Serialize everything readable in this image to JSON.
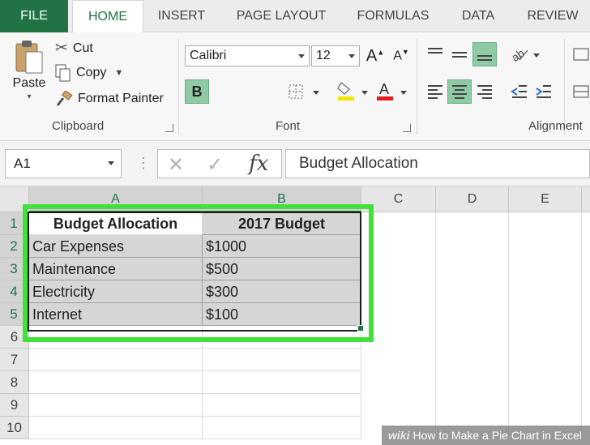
{
  "tabs": {
    "file": "FILE",
    "home": "HOME",
    "insert": "INSERT",
    "page_layout": "PAGE LAYOUT",
    "formulas": "FORMULAS",
    "data": "DATA",
    "review": "REVIEW"
  },
  "ribbon": {
    "clipboard": {
      "paste": "Paste",
      "cut": "Cut",
      "copy": "Copy",
      "format_painter": "Format Painter",
      "label": "Clipboard"
    },
    "font": {
      "family": "Calibri",
      "size": "12",
      "bold": "B",
      "label": "Font"
    },
    "alignment": {
      "label": "Alignment"
    }
  },
  "formula_bar": {
    "name_box": "A1",
    "fx": "fx",
    "content": "Budget Allocation"
  },
  "grid": {
    "columns": [
      "A",
      "B",
      "C",
      "D",
      "E"
    ],
    "rows": [
      "1",
      "2",
      "3",
      "4",
      "5",
      "6",
      "7",
      "8",
      "9",
      "10"
    ],
    "cells": [
      [
        "Budget Allocation",
        "2017 Budget"
      ],
      [
        "Car Expenses",
        "$1000"
      ],
      [
        "Maintenance",
        "$500"
      ],
      [
        "Electricity",
        "$300"
      ],
      [
        "Internet",
        "$100"
      ]
    ]
  },
  "colors": {
    "excel_green": "#217346",
    "highlight": "#42e03a"
  },
  "watermark": {
    "wiki": "wiki",
    "text": "How to Make a Pie Chart in Excel"
  }
}
